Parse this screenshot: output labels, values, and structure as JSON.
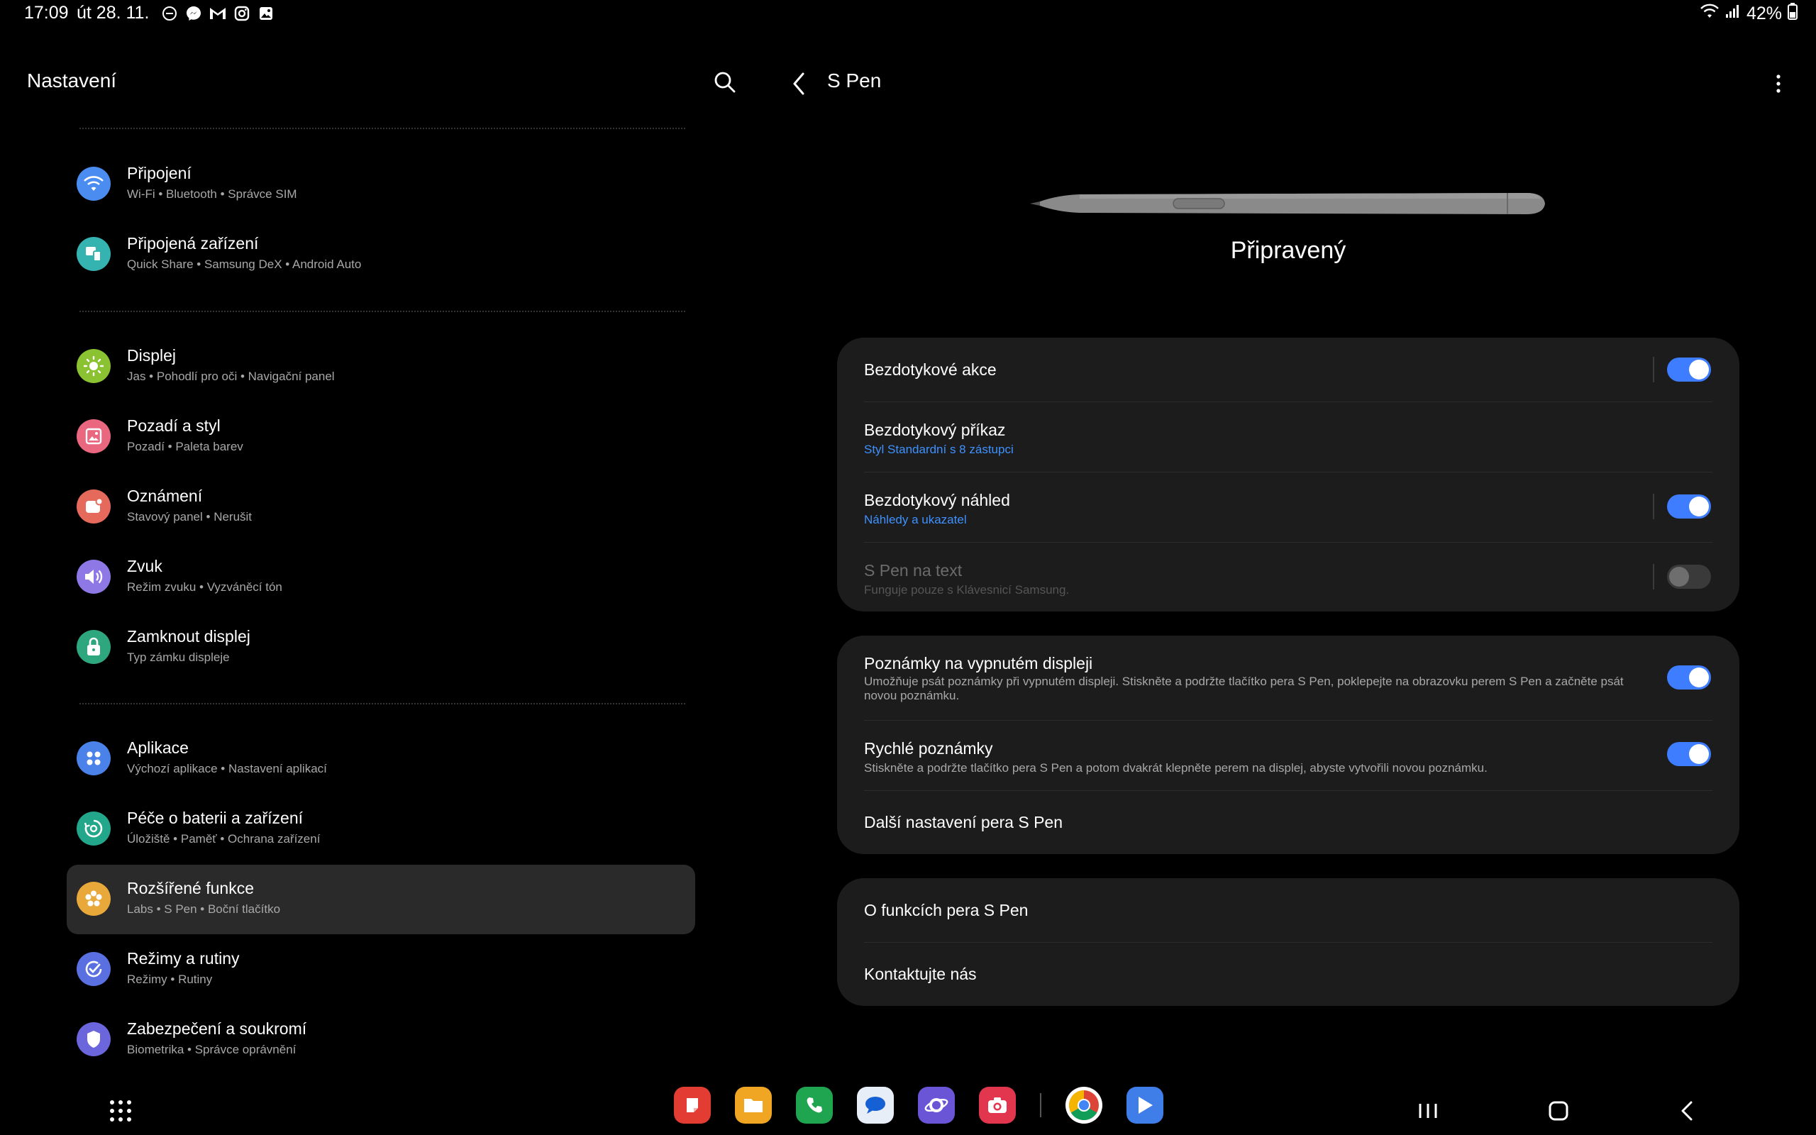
{
  "status_bar": {
    "time": "17:09",
    "date": "út 28. 11.",
    "notification_icons": [
      "do-not-disturb-icon",
      "messenger-icon",
      "gmail-icon",
      "instagram-icon",
      "gallery-icon"
    ],
    "battery": "42%"
  },
  "left_pane": {
    "title": "Nastavení",
    "groups": [
      [
        {
          "id": "pripojeni",
          "title": "Připojení",
          "subtitle": "Wi-Fi  •  Bluetooth  •  Správce SIM",
          "icon": "wifi-icon",
          "color": "#4a8cf0"
        },
        {
          "id": "pripojena-zarizeni",
          "title": "Připojená zařízení",
          "subtitle": "Quick Share  •  Samsung DeX  •  Android Auto",
          "icon": "devices-icon",
          "color": "#35b3b0"
        }
      ],
      [
        {
          "id": "displej",
          "title": "Displej",
          "subtitle": "Jas  •  Pohodlí pro oči  •  Navigační panel",
          "icon": "sun-icon",
          "color": "#8ac232"
        },
        {
          "id": "pozadi",
          "title": "Pozadí a styl",
          "subtitle": "Pozadí  •  Paleta barev",
          "icon": "palette-icon",
          "color": "#e9677f"
        },
        {
          "id": "oznameni",
          "title": "Oznámení",
          "subtitle": "Stavový panel  •  Nerušit",
          "icon": "notification-icon",
          "color": "#e66a5c"
        },
        {
          "id": "zvuk",
          "title": "Zvuk",
          "subtitle": "Režim zvuku  •  Vyzváněcí tón",
          "icon": "speaker-icon",
          "color": "#8d78e6"
        },
        {
          "id": "zamknout",
          "title": "Zamknout displej",
          "subtitle": "Typ zámku displeje",
          "icon": "lock-icon",
          "color": "#2fa77e"
        }
      ],
      [
        {
          "id": "aplikace",
          "title": "Aplikace",
          "subtitle": "Výchozí aplikace  •  Nastavení aplikací",
          "icon": "apps-grid-icon",
          "color": "#4a82ea"
        },
        {
          "id": "pece",
          "title": "Péče o baterii a zařízení",
          "subtitle": "Úložiště  •  Paměť  •  Ochrana zařízení",
          "icon": "device-care-icon",
          "color": "#22a78a"
        },
        {
          "id": "rozsirene",
          "title": "Rozšířené funkce",
          "subtitle": "Labs  •  S Pen  •  Boční tlačítko",
          "icon": "gear-flower-icon",
          "color": "#e8a93a",
          "active": true
        },
        {
          "id": "rezimy",
          "title": "Režimy a rutiny",
          "subtitle": "Režimy  •  Rutiny",
          "icon": "check-circle-icon",
          "color": "#5a6fe0"
        },
        {
          "id": "zabezpeceni",
          "title": "Zabezpečení a soukromí",
          "subtitle": "Biometrika  •  Správce oprávnění",
          "icon": "shield-icon",
          "color": "#6b66dc"
        }
      ]
    ]
  },
  "right_pane": {
    "title": "S Pen",
    "status": "Připravený",
    "cards": [
      [
        {
          "id": "bezdotykove-akce",
          "title": "Bezdotykové akce",
          "toggle": true,
          "has_divider": true
        },
        {
          "id": "bezdotykovy-prikaz",
          "title": "Bezdotykový příkaz",
          "subtitle": "Styl Standardní s 8 zástupci",
          "subtitle_link": true
        },
        {
          "id": "bezdotykovy-nahled",
          "title": "Bezdotykový náhled",
          "subtitle": "Náhledy a ukazatel",
          "subtitle_link": true,
          "toggle": true,
          "has_divider": true
        },
        {
          "id": "s-pen-na-text",
          "title": "S Pen na text",
          "subtitle": "Funguje pouze s Klávesnicí Samsung.",
          "toggle": false,
          "disabled": true,
          "has_divider": true
        }
      ],
      [
        {
          "id": "poznamky-vypnuty",
          "title": "Poznámky na vypnutém displeji",
          "subtitle": "Umožňuje psát poznámky při vypnutém displeji. Stiskněte a podržte tlačítko pera S Pen, poklepejte na obrazovku perem S Pen a začněte psát novou poznámku.",
          "toggle": true
        },
        {
          "id": "rychle-poznamky",
          "title": "Rychlé poznámky",
          "subtitle": "Stiskněte a podržte tlačítko pera S Pen a potom dvakrát klepněte perem na displej, abyste vytvořili novou poznámku.",
          "toggle": true
        },
        {
          "id": "dalsi-nastaveni",
          "title": "Další nastavení pera S Pen"
        }
      ],
      [
        {
          "id": "o-funkcich",
          "title": "O funkcích pera S Pen"
        },
        {
          "id": "kontaktujte",
          "title": "Kontaktujte nás"
        }
      ]
    ]
  },
  "dock": [
    {
      "id": "notes",
      "icon": "samsung-notes-icon",
      "color": "#e23c33"
    },
    {
      "id": "files",
      "icon": "my-files-icon",
      "color": "#f0a523"
    },
    {
      "id": "phone",
      "icon": "phone-icon",
      "color": "#1fa44f"
    },
    {
      "id": "messages",
      "icon": "messages-icon",
      "color": "#e8eef8"
    },
    {
      "id": "internet",
      "icon": "samsung-internet-icon",
      "color": "#6a55d6"
    },
    {
      "id": "camera",
      "icon": "camera-icon",
      "color": "#e2364f"
    },
    {
      "id": "chrome",
      "icon": "chrome-icon",
      "color": "#ffffff"
    },
    {
      "id": "play",
      "icon": "play-store-icon",
      "color": "#3f7ee8"
    }
  ]
}
